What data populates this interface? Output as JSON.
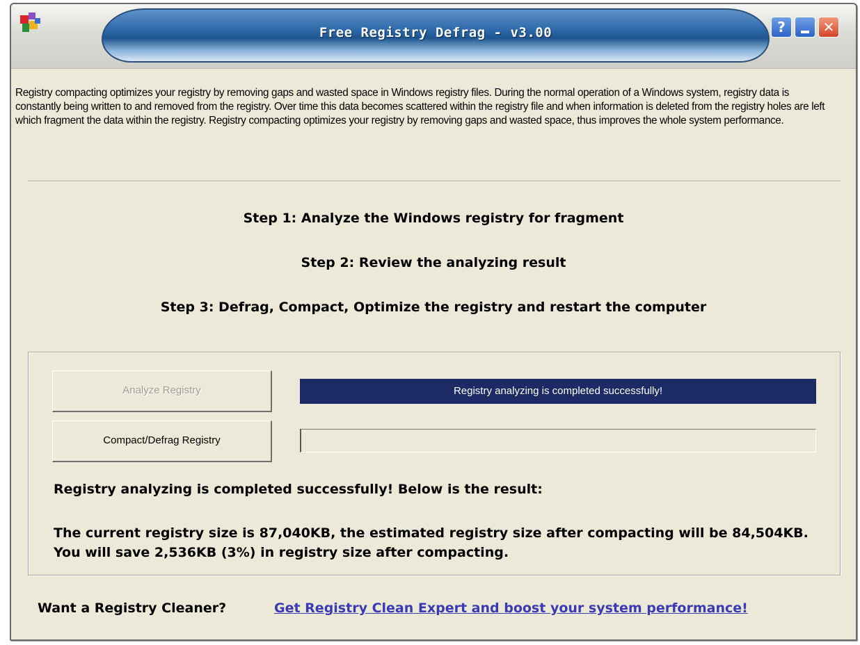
{
  "window": {
    "title": "Free Registry Defrag - v3.00",
    "controls": {
      "help": "?",
      "minimize": "minimize",
      "close": "✕"
    }
  },
  "description": "Registry compacting optimizes your registry by removing gaps and wasted space in Windows registry files. During the normal operation of a Windows system, registry data is constantly being written to and removed from the registry. Over time this data becomes scattered within the registry file and when information is deleted from the registry holes are left which fragment the data within the registry. Registry compacting optimizes your registry by removing gaps and wasted space, thus improves the whole system performance.",
  "steps": [
    "Step 1: Analyze the Windows registry for fragment",
    "Step 2: Review the analyzing result",
    "Step 3: Defrag, Compact, Optimize the registry and restart the computer"
  ],
  "buttons": {
    "analyze": {
      "label": "Analyze Registry",
      "enabled": false
    },
    "compact": {
      "label": "Compact/Defrag Registry",
      "enabled": true
    }
  },
  "status": {
    "message": "Registry analyzing is completed successfully!",
    "progress_fraction": 0.0
  },
  "result": {
    "heading": "Registry analyzing is completed successfully! Below is the result:",
    "detail": "The current registry size is 87,040KB, the estimated registry size after compacting will be 84,504KB. You will save 2,536KB (3%) in registry size after compacting."
  },
  "promo": {
    "label": "Want a Registry Cleaner?",
    "link": "Get Registry Clean Expert and boost your system performance!"
  },
  "colors": {
    "status_bar": "#1c2a66",
    "link": "#3a3ab4",
    "window_bg": "#ece9d8",
    "close_button": "#d4432a"
  },
  "icons": [
    "app-icon",
    "help-icon",
    "minimize-icon",
    "close-icon"
  ]
}
